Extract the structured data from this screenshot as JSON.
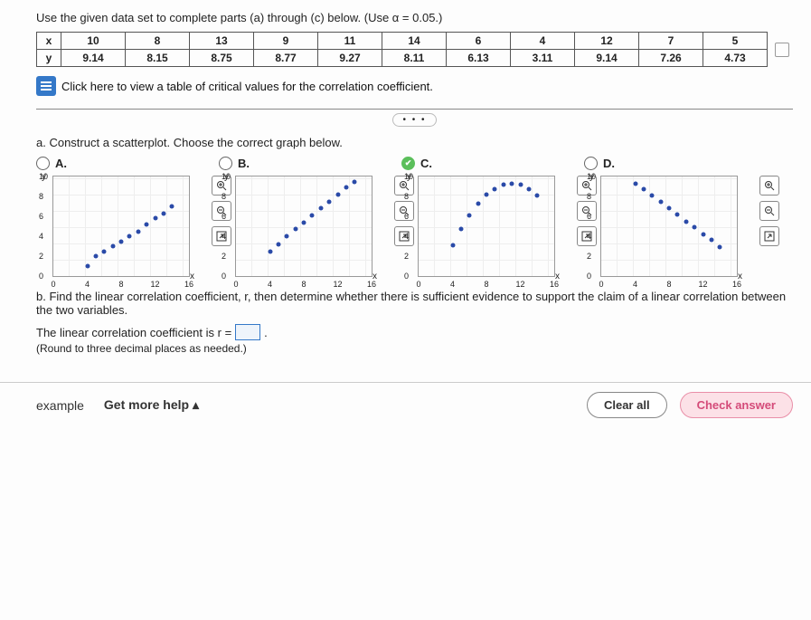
{
  "instruction": "Use the given data set to complete parts (a) through (c) below. (Use α = 0.05.)",
  "table": {
    "rows": [
      {
        "label": "x",
        "vals": [
          "10",
          "8",
          "13",
          "9",
          "11",
          "14",
          "6",
          "4",
          "12",
          "7",
          "5"
        ]
      },
      {
        "label": "y",
        "vals": [
          "9.14",
          "8.15",
          "8.75",
          "8.77",
          "9.27",
          "8.11",
          "6.13",
          "3.11",
          "9.14",
          "7.26",
          "4.73"
        ]
      }
    ]
  },
  "link_text": "Click here to view a table of critical values for the correlation coefficient.",
  "part_a": "a. Construct a scatterplot. Choose the correct graph below.",
  "choices": [
    "A.",
    "B.",
    "C.",
    "D."
  ],
  "selected": "C.",
  "axes": {
    "ylabel": "y",
    "xlabel": "x",
    "xticks": [
      "0",
      "4",
      "8",
      "12",
      "16"
    ],
    "yticks": [
      "0",
      "2",
      "4",
      "6",
      "8",
      "10"
    ]
  },
  "yticks_c": [
    "0",
    "2",
    "4",
    "6",
    "8",
    "10"
  ],
  "part_b": "b. Find the linear correlation coefficient, r, then determine whether there is sufficient evidence to support the claim of a linear correlation between the two variables.",
  "eq_text": "The linear correlation coefficient is r =",
  "eq_after": ".",
  "round_note": "(Round to three decimal places as needed.)",
  "foot": {
    "example": "example",
    "more": "Get more help",
    "clear": "Clear all",
    "check": "Check answer"
  },
  "chart_data": [
    {
      "type": "scatter",
      "label": "A",
      "xlim": [
        0,
        16
      ],
      "ylim": [
        0,
        10
      ],
      "xlabel": "x",
      "ylabel": "y",
      "points": [
        [
          4,
          1
        ],
        [
          5,
          2
        ],
        [
          6,
          2.5
        ],
        [
          7,
          3
        ],
        [
          8,
          3.5
        ],
        [
          9,
          4
        ],
        [
          10,
          4.5
        ],
        [
          11,
          5.2
        ],
        [
          12,
          5.8
        ],
        [
          13,
          6.3
        ],
        [
          14,
          7
        ]
      ]
    },
    {
      "type": "scatter",
      "label": "B",
      "xlim": [
        0,
        16
      ],
      "ylim": [
        0,
        10
      ],
      "xlabel": "x",
      "ylabel": "y",
      "points": [
        [
          4,
          2.5
        ],
        [
          5,
          3.2
        ],
        [
          6,
          4
        ],
        [
          7,
          4.7
        ],
        [
          8,
          5.4
        ],
        [
          9,
          6.1
        ],
        [
          10,
          6.8
        ],
        [
          11,
          7.5
        ],
        [
          12,
          8.2
        ],
        [
          13,
          8.9
        ],
        [
          14,
          9.5
        ]
      ]
    },
    {
      "type": "scatter",
      "label": "C",
      "xlim": [
        0,
        16
      ],
      "ylim": [
        0,
        10
      ],
      "xlabel": "x",
      "ylabel": "y",
      "points": [
        [
          4,
          3.11
        ],
        [
          5,
          4.73
        ],
        [
          6,
          6.13
        ],
        [
          7,
          7.26
        ],
        [
          8,
          8.15
        ],
        [
          9,
          8.77
        ],
        [
          10,
          9.14
        ],
        [
          11,
          9.27
        ],
        [
          12,
          9.14
        ],
        [
          13,
          8.75
        ],
        [
          14,
          8.11
        ]
      ]
    },
    {
      "type": "scatter",
      "label": "D",
      "xlim": [
        0,
        16
      ],
      "ylim": [
        0,
        10
      ],
      "xlabel": "x",
      "ylabel": "y",
      "points": [
        [
          4,
          9.3
        ],
        [
          5,
          8.7
        ],
        [
          6,
          8.1
        ],
        [
          7,
          7.5
        ],
        [
          8,
          6.8
        ],
        [
          9,
          6.2
        ],
        [
          10,
          5.5
        ],
        [
          11,
          4.9
        ],
        [
          12,
          4.2
        ],
        [
          13,
          3.6
        ],
        [
          14,
          2.9
        ]
      ]
    }
  ]
}
